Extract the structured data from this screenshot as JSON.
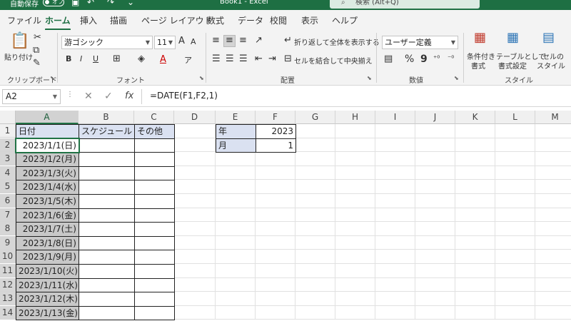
{
  "titlebar": {
    "autosave_label": "自動保存",
    "autosave_state": "オフ",
    "doc_title": "Book1  -  Excel",
    "search_placeholder": "検索 (Alt+Q)"
  },
  "tabs": [
    "ファイル",
    "ホーム",
    "挿入",
    "描画",
    "ページ レイアウト",
    "数式",
    "データ",
    "校閲",
    "表示",
    "ヘルプ"
  ],
  "active_tab": "ホーム",
  "ribbon": {
    "clipboard": {
      "paste_label": "貼り付け",
      "group": "クリップボード"
    },
    "font": {
      "name": "游ゴシック",
      "size": "11",
      "group": "フォント",
      "bold": "B",
      "italic": "I",
      "underline": "U",
      "grow": "A",
      "shrink": "A",
      "color_a": "A",
      "fill_label": "ア"
    },
    "alignment": {
      "wrap_label": "折り返して全体を表示する",
      "merge_label": "セルを結合して中央揃え",
      "group": "配置"
    },
    "number": {
      "format": "ユーザー定義",
      "group": "数値",
      "percent": "%",
      "comma": "9"
    },
    "styles": {
      "conditional_label1": "条件付き",
      "conditional_label2": "書式",
      "table_label1": "テーブルとして",
      "table_label2": "書式設定",
      "cell_label1": "セルの",
      "cell_label2": "スタイル",
      "group": "スタイル"
    }
  },
  "formulabar": {
    "name_box": "A2",
    "formula": "=DATE(F1,F2,1)",
    "fx": "fx"
  },
  "sheet": {
    "columns": [
      "A",
      "B",
      "C",
      "D",
      "E",
      "F",
      "G",
      "H",
      "I",
      "J",
      "K",
      "L",
      "M"
    ],
    "selected_column": "A",
    "rows": [
      "1",
      "2",
      "3",
      "4",
      "5",
      "6",
      "7",
      "8",
      "9",
      "10",
      "11",
      "12",
      "13",
      "14"
    ],
    "header_row": {
      "A": "日付",
      "B": "スケジュール",
      "C": "その他"
    },
    "dates": [
      "2023/1/1(日)",
      "2023/1/2(月)",
      "2023/1/3(火)",
      "2023/1/4(水)",
      "2023/1/5(木)",
      "2023/1/6(金)",
      "2023/1/7(土)",
      "2023/1/8(日)",
      "2023/1/9(月)",
      "2023/1/10(火)",
      "2023/1/11(水)",
      "2023/1/12(木)",
      "2023/1/13(金)"
    ],
    "params": [
      {
        "label": "年",
        "value": "2023"
      },
      {
        "label": "月",
        "value": "1"
      }
    ],
    "active_cell": "A2"
  }
}
